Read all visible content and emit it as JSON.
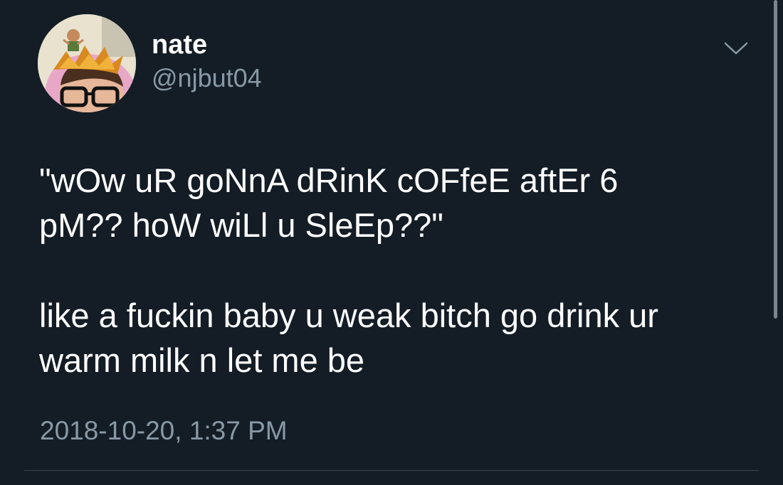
{
  "tweet": {
    "author": {
      "display_name": "nate",
      "handle": "@njbut04",
      "avatar_icon": "avatar-photo"
    },
    "menu_icon": "chevron-down-icon",
    "paragraphs": [
      {
        "lines": [
          "\"wOw uR goNnA dRinK cOFfeE aftEr 6",
          "pM?? hoW wiLl u SleEp??\""
        ]
      },
      {
        "lines": [
          "like a fuckin baby u weak bitch go drink ur",
          "warm milk n let me be"
        ]
      }
    ],
    "timestamp": "2018-10-20, 1:37 PM"
  },
  "colors": {
    "background": "#141d26",
    "primary_text": "#ffffff",
    "secondary_text": "#8899a6",
    "divider": "#38444d"
  }
}
